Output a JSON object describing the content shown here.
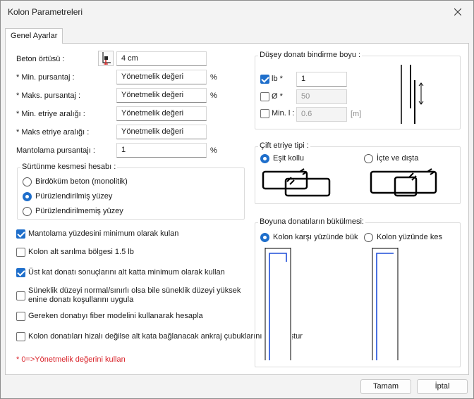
{
  "window": {
    "title": "Kolon Parametreleri"
  },
  "tab": {
    "label": "Genel Ayarlar"
  },
  "left": {
    "beton_ortusu": {
      "label": "Beton örtüsü :",
      "value": "4 cm"
    },
    "min_pursantaj": {
      "label": "* Min.  pursantaj :",
      "value": "Yönetmelik değeri",
      "unit": "%"
    },
    "maks_pursantaj": {
      "label": "* Maks. pursantaj :",
      "value": "Yönetmelik değeri",
      "unit": "%"
    },
    "min_etriye": {
      "label": "* Min.  etriye aralığı :",
      "value": "Yönetmelik değeri"
    },
    "maks_etriye": {
      "label": "* Maks etriye aralığı :",
      "value": "Yönetmelik değeri"
    },
    "mantolama": {
      "label": "Mantolama pursantajı :",
      "value": "1",
      "unit": "%"
    },
    "surtunme": {
      "title": "Sürtünme kesmesi hesabı :",
      "options": [
        "Birdöküm beton (monolitik)",
        "Pürüzlendirilmiş yüzey",
        "Pürüzlendirilmemiş yüzey"
      ],
      "selected": 1
    },
    "checks": [
      {
        "label": "Mantolama yüzdesini minimum olarak kulan",
        "checked": true
      },
      {
        "label": "Kolon alt sarılma bölgesi 1.5 lb",
        "checked": false
      },
      {
        "label": "Üst kat donatı sonuçlarını alt katta minimum olarak kullan",
        "checked": true
      },
      {
        "label": "Süneklik düzeyi normal/sınırlı olsa bile süneklik düzeyi yüksek",
        "label2": "enine donatı koşullarını uygula",
        "checked": false
      },
      {
        "label": "Gereken donatıyı fiber modelini kullanarak hesapla",
        "checked": false
      },
      {
        "label": "Kolon donatıları hizalı değilse alt kata bağlanacak ankraj çubuklarını ayrı oluştur",
        "checked": false
      }
    ],
    "note": "* 0=>Yönetmelik değerini kullan"
  },
  "right": {
    "bindirme": {
      "title": "Düşey donatı bindirme boyu :",
      "lb": {
        "label": "lb *",
        "value": "1",
        "checked": true
      },
      "phi": {
        "label": "Ø *",
        "value": "50",
        "checked": false
      },
      "minl": {
        "label": "Min. l :",
        "value": "0.6",
        "unit": "[m]",
        "checked": false
      }
    },
    "etriye_tipi": {
      "title": "Çift etriye tipi :",
      "options": [
        "Eşit kollu",
        "İçte ve dışta"
      ],
      "selected": 0
    },
    "bukulme": {
      "title": "Boyuna donatıların bükülmesi:",
      "options": [
        "Kolon karşı yüzünde bük",
        "Kolon yüzünde kes"
      ],
      "selected": 0
    }
  },
  "footer": {
    "ok": "Tamam",
    "cancel": "İptal"
  },
  "colors": {
    "accent": "#1f6fcb",
    "note": "#d9232a",
    "diagram_line": "#1f4ed8"
  }
}
